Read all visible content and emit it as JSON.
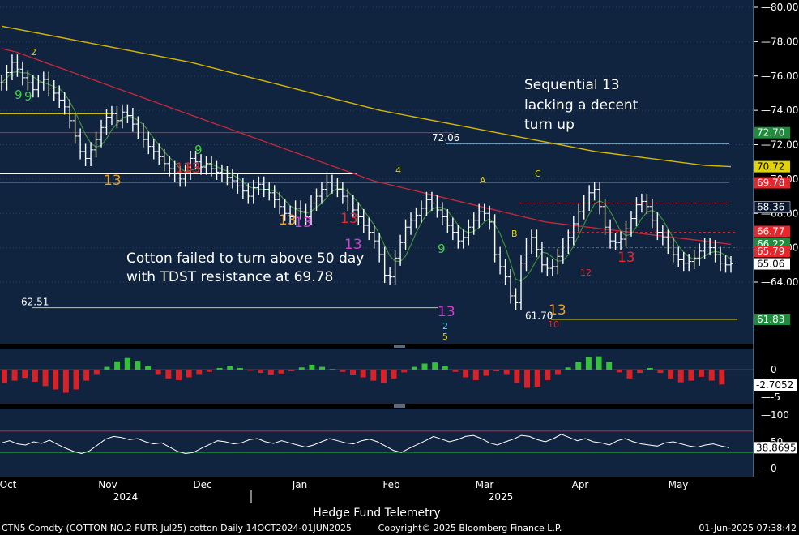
{
  "chart_data": {
    "type": "line",
    "instrument": "CTN5 Comdty (COTTON NO.2 FUTR  Jul25) cotton  Daily 14OCT2024-01JUN2025",
    "price_axis": {
      "ylim": [
        61,
        80.5
      ],
      "ticks": [
        "80.00",
        "78.00",
        "76.00",
        "74.00",
        "72.00",
        "70.00",
        "68.00",
        "66.00",
        "64.00"
      ]
    },
    "x_ticks": [
      "Oct",
      "Nov",
      "Dec",
      "Jan",
      "Feb",
      "Mar",
      "Apr",
      "May"
    ],
    "years": [
      "2024",
      "2025"
    ],
    "price_series": [
      75.6,
      76.2,
      76.8,
      76.4,
      75.9,
      75.6,
      75.2,
      75.6,
      75.8,
      75.3,
      75.0,
      74.6,
      74.2,
      73.4,
      72.5,
      71.6,
      71.2,
      71.7,
      72.3,
      73.0,
      73.6,
      73.8,
      73.4,
      73.9,
      73.7,
      73.2,
      72.8,
      72.3,
      71.9,
      71.6,
      71.3,
      70.9,
      70.6,
      70.3,
      70.0,
      70.4,
      71.2,
      71.0,
      70.7,
      70.9,
      70.6,
      70.4,
      70.3,
      70.1,
      69.9,
      69.6,
      69.3,
      69.0,
      69.5,
      69.7,
      69.4,
      69.2,
      68.8,
      68.4,
      68.0,
      67.8,
      68.3,
      68.1,
      67.8,
      68.6,
      69.0,
      69.4,
      69.8,
      69.6,
      69.4,
      69.0,
      68.6,
      68.2,
      67.8,
      67.3,
      66.9,
      66.4,
      65.6,
      64.4,
      64.3,
      65.4,
      66.3,
      67.2,
      67.6,
      67.9,
      68.3,
      68.8,
      68.6,
      68.2,
      67.8,
      67.3,
      66.9,
      66.4,
      66.6,
      67.2,
      67.6,
      68.1,
      68.0,
      67.5,
      65.6,
      64.9,
      64.3,
      63.2,
      62.8,
      65.1,
      66.1,
      66.6,
      65.9,
      65.0,
      64.8,
      64.9,
      65.5,
      66.1,
      66.6,
      67.4,
      68.1,
      68.6,
      69.2,
      69.4,
      68.4,
      67.2,
      66.4,
      66.3,
      66.5,
      67.1,
      67.7,
      68.5,
      68.7,
      68.4,
      67.6,
      66.9,
      66.6,
      66.1,
      65.6,
      65.3,
      65.1,
      65.2,
      65.4,
      65.8,
      66.1,
      66.0,
      65.6,
      65.1,
      65.0,
      65.06
    ],
    "ma_50_day": [
      77.6,
      77.4,
      77.1,
      76.8,
      76.5,
      76.2,
      75.9,
      75.6,
      75.3,
      75.0,
      74.7,
      74.4,
      74.1,
      73.8,
      73.5,
      73.2,
      72.9,
      72.6,
      72.3,
      72.0,
      71.7,
      71.4,
      71.1,
      70.8,
      70.5,
      70.2,
      69.9,
      69.7,
      69.5,
      69.3,
      69.1,
      68.9,
      68.7,
      68.5,
      68.3,
      68.1,
      67.9,
      67.7,
      67.5,
      67.4,
      67.3,
      67.2,
      67.1,
      67.0,
      66.9,
      66.8,
      66.7,
      66.6,
      66.5,
      66.4,
      66.3,
      66.2
    ],
    "ma_200_day": [
      78.9,
      78.6,
      78.3,
      78.0,
      77.7,
      77.4,
      77.1,
      76.8,
      76.4,
      76.0,
      75.6,
      75.2,
      74.8,
      74.4,
      74.0,
      73.7,
      73.4,
      73.1,
      72.8,
      72.5,
      72.2,
      71.9,
      71.6,
      71.4,
      71.2,
      71.0,
      70.8,
      70.72
    ],
    "right_tags": [
      {
        "text": "72.70",
        "bg": "#1e8c3a",
        "fg": "#ffffff",
        "v": 72.7
      },
      {
        "text": "70.72",
        "bg": "#e3d400",
        "fg": "#000000",
        "v": 70.72
      },
      {
        "text": "69.78",
        "bg": "#e8262b",
        "fg": "#ffffff",
        "v": 69.78
      },
      {
        "text": "68.36",
        "bg": "#0b1830",
        "fg": "#ffffff",
        "v": 68.36
      },
      {
        "text": "66.77",
        "bg": "#e8262b",
        "fg": "#ffffff",
        "v": 66.95
      },
      {
        "text": "66.22",
        "bg": "#1e8c3a",
        "fg": "#ffffff",
        "v": 66.22
      },
      {
        "text": "65.79",
        "bg": "#e8262b",
        "fg": "#ffffff",
        "v": 65.79
      },
      {
        "text": "65.06",
        "bg": "#ffffff",
        "fg": "#000000",
        "v": 65.06
      },
      {
        "text": "61.83",
        "bg": "#1e8c3a",
        "fg": "#ffffff",
        "v": 61.83
      }
    ],
    "level_labels": [
      {
        "text": "72.06",
        "color": "#5fd7ff",
        "v": 72.06
      },
      {
        "text": "62.51",
        "color": "#e3d400",
        "v": 62.51
      },
      {
        "text": "61.70",
        "color": "#e3d400",
        "v": 61.7
      }
    ],
    "annotations": [
      "Sequential 13",
      "lacking a decent",
      "turn up",
      "Cotton failed to turn above 50 day",
      "with TDST resistance at 69.78"
    ],
    "macd_panel": {
      "ticks": [
        "0",
        "-5"
      ],
      "last_value": "-2.7052",
      "histogram": [
        -2.4,
        -2.0,
        -1.5,
        -2.2,
        -3.0,
        -3.6,
        -4.2,
        -3.6,
        -2.0,
        -0.8,
        0.5,
        1.5,
        2.1,
        1.6,
        0.6,
        -0.8,
        -1.6,
        -1.9,
        -1.4,
        -0.8,
        -0.4,
        0.3,
        0.7,
        0.3,
        -0.2,
        -0.6,
        -0.9,
        -0.7,
        -0.3,
        0.4,
        0.9,
        0.5,
        0.1,
        -0.4,
        -0.9,
        -1.4,
        -2.0,
        -2.4,
        -1.6,
        -0.5,
        0.5,
        1.1,
        1.3,
        0.6,
        -0.4,
        -1.4,
        -1.9,
        -1.1,
        -0.3,
        -0.8,
        -2.4,
        -3.3,
        -3.1,
        -1.9,
        -0.8,
        0.4,
        1.4,
        2.3,
        2.4,
        1.4,
        -0.5,
        -1.6,
        -0.6,
        0.3,
        -0.6,
        -1.6,
        -2.3,
        -2.0,
        -1.3,
        -2.0,
        -2.7
      ]
    },
    "oscillator_panel": {
      "ticks": [
        "100",
        "50",
        "0"
      ],
      "last_value": "38.8695",
      "upper_line": 70,
      "lower_line": 30,
      "series": [
        48,
        52,
        46,
        44,
        50,
        47,
        53,
        45,
        38,
        32,
        28,
        33,
        44,
        55,
        60,
        58,
        54,
        56,
        50,
        46,
        48,
        40,
        32,
        28,
        30,
        38,
        45,
        52,
        50,
        46,
        48,
        54,
        56,
        50,
        47,
        52,
        48,
        44,
        40,
        44,
        50,
        56,
        52,
        48,
        46,
        52,
        55,
        50,
        42,
        34,
        30,
        38,
        45,
        52,
        60,
        55,
        50,
        54,
        60,
        62,
        56,
        48,
        44,
        50,
        55,
        62,
        60,
        54,
        50,
        56,
        64,
        58,
        52,
        56,
        50,
        48,
        44,
        52,
        56,
        50,
        46,
        44,
        42,
        48,
        50,
        46,
        42,
        40,
        44,
        46,
        42,
        38.87
      ]
    },
    "footer": {
      "left": "CTN5 Comdty (COTTON NO.2 FUTR  Jul25) cotton  Daily 14OCT2024-01JUN2025",
      "center": "Copyright© 2025 Bloomberg Finance L.P.",
      "right": "01-Jun-2025 07:38:42",
      "watermark": "Hedge Fund Telemetry"
    }
  },
  "setup_counts": {
    "green_nines": [
      "9",
      "9",
      "9",
      "9"
    ],
    "red_thirteens": [
      "13",
      "13",
      "13",
      "13"
    ],
    "magenta_thirteens": [
      "13",
      "13",
      "13"
    ],
    "orange_thirteens": [
      "13",
      "13",
      "13"
    ],
    "other_labels": [
      "2",
      "4",
      "A",
      "B",
      "C",
      "5",
      "10",
      "2",
      "12"
    ]
  }
}
